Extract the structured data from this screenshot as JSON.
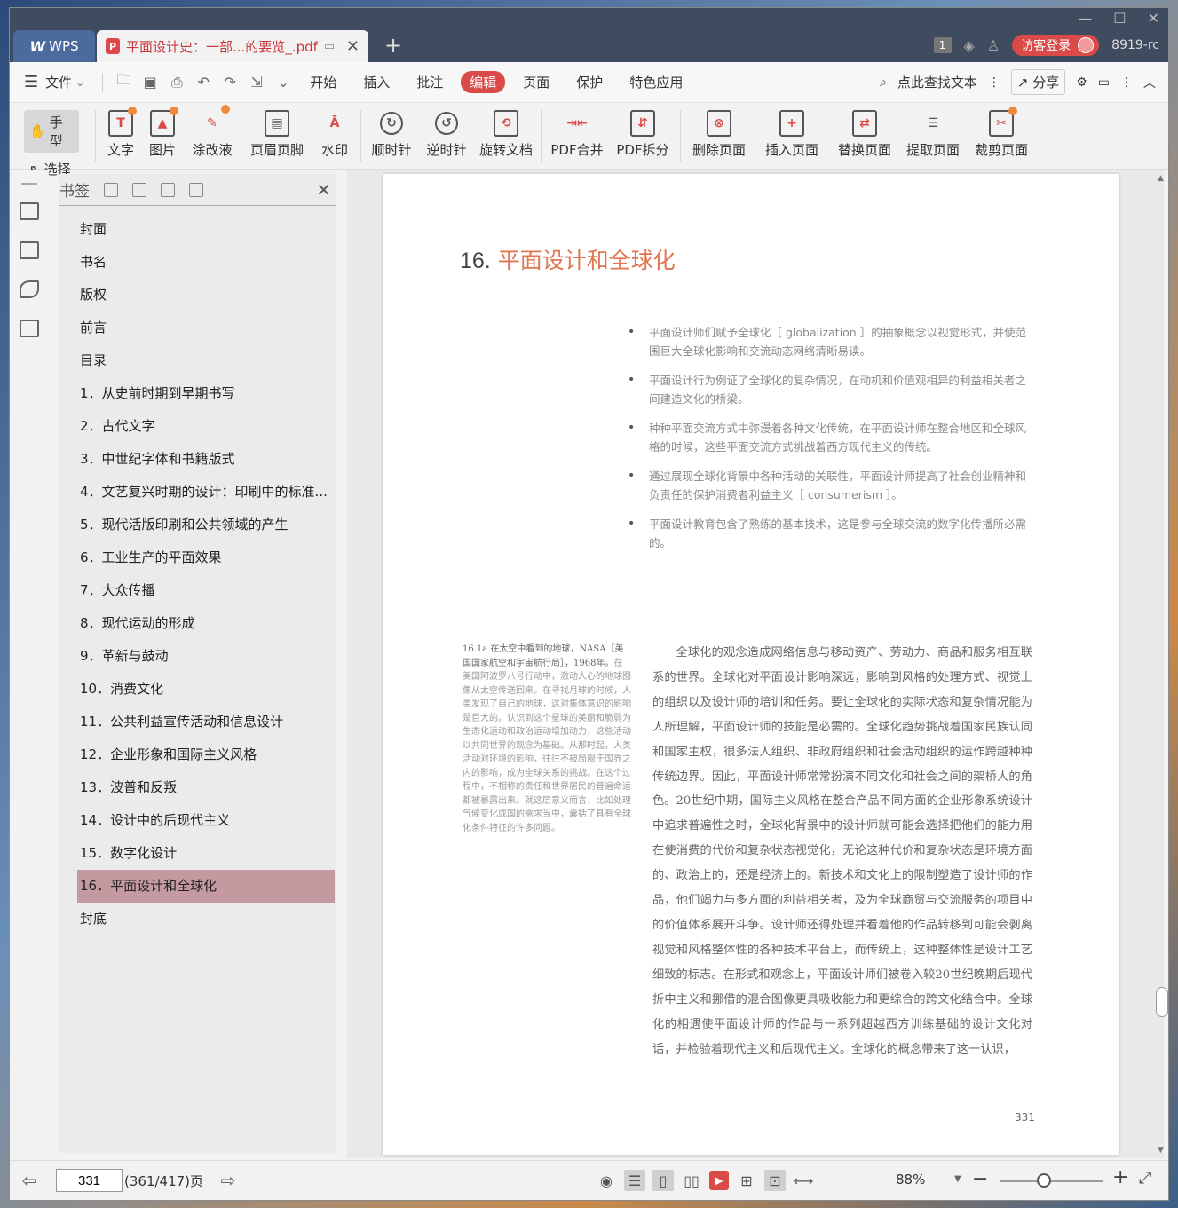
{
  "titlebar": {
    "app_tab": "WPS",
    "doc_tab": "平面设计史：一部...的要览_.pdf",
    "page_badge": "1",
    "login_button": "访客登录",
    "user_id": "8919-rc"
  },
  "menubar": {
    "file": "文件",
    "items": [
      "开始",
      "插入",
      "批注",
      "编辑",
      "页面",
      "保护",
      "特色应用"
    ],
    "active": "编辑",
    "search_text": "点此查找文本",
    "share": "分享"
  },
  "ribbon": {
    "hand": "手型",
    "select": "选择",
    "buttons": [
      "文字",
      "图片",
      "涂改液",
      "页眉页脚",
      "水印",
      "顺时针",
      "逆时针",
      "旋转文档",
      "PDF合并",
      "PDF拆分",
      "删除页面",
      "插入页面",
      "替换页面",
      "提取页面",
      "裁剪页面"
    ]
  },
  "bookmarks": {
    "title": "书签",
    "items": [
      "封面",
      "书名",
      "版权",
      "前言",
      "目录",
      "1．从史前时期到早期书写",
      "2．古代文字",
      "3．中世纪字体和书籍版式",
      "4．文艺复兴时期的设计：印刷中的标准...",
      "5．现代活版印刷和公共领域的产生",
      "6．工业生产的平面效果",
      "7．大众传播",
      "8．现代运动的形成",
      "9．革新与鼓动",
      "10．消费文化",
      "11．公共利益宣传活动和信息设计",
      "12．企业形象和国际主义风格",
      "13．波普和反叛",
      "14．设计中的后现代主义",
      "15．数字化设计",
      "16．平面设计和全球化",
      "封底"
    ],
    "active_index": 20
  },
  "page": {
    "chapter_number": "16.",
    "chapter_title": "平面设计和全球化",
    "bullets": [
      "平面设计师们赋予全球化［ globalization ］的抽象概念以视觉形式，并使范围巨大全球化影响和交流动态网络清晰易读。",
      "平面设计行为例证了全球化的复杂情况，在动机和价值观相异的利益相关者之间建造文化的桥梁。",
      "种种平面交流方式中弥漫着各种文化传统，在平面设计师在整合地区和全球风格的时候，这些平面交流方式挑战着西方现代主义的传统。",
      "通过展现全球化背景中各种活动的关联性，平面设计师提高了社会创业精神和负责任的保护消费者利益主义［ consumerism ］。",
      "平面设计教育包含了熟练的基本技术，这是参与全球交流的数字化传播所必需的。"
    ],
    "caption_head": "16.1a 在太空中看到的地球，NASA［美国国家航空和宇宙航行局］，1968年。",
    "caption_body": "在美国阿波罗八号行动中，激动人心的地球图像从太空传送回来。在寻找月球的时候，人类发现了自己的地球，这对集体意识的影响是巨大的。认识到这个星球的美丽和脆弱为生态化运动和政治运动增加动力，这些活动以共同世界的观念为基础。从那时起，人类活动对环境的影响，往往不被局限于国界之内的影响，成为全球关系的挑战。在这个过程中，不相称的责任和世界居民的普遍命运都被暴露出来。就这层意义而言，比如处理气候变化或国的需求当中，囊括了具有全球化条件特征的许多问题。",
    "body": "全球化的观念造成网络信息与移动资产、劳动力、商品和服务相互联系的世界。全球化对平面设计影响深远，影响到风格的处理方式、视觉上的组织以及设计师的培训和任务。要让全球化的实际状态和复杂情况能为人所理解，平面设计师的技能是必需的。全球化趋势挑战着国家民族认同和国家主权，很多法人组织、非政府组织和社会活动组织的运作跨越种种传统边界。因此，平面设计师常常扮演不同文化和社会之间的架桥人的角色。20世纪中期，国际主义风格在整合产品不同方面的企业形象系统设计中追求普遍性之时，全球化背景中的设计师就可能会选择把他们的能力用在使消费的代价和复杂状态视觉化，无论这种代价和复杂状态是环境方面的、政治上的，还是经济上的。新技术和文化上的限制塑造了设计师的作品，他们竭力与多方面的利益相关者，及为全球商贸与交流服务的项目中的价值体系展开斗争。设计师还得处理并看着他的作品转移到可能会剥离视觉和风格整体性的各种技术平台上，而传统上，这种整体性是设计工艺细致的标志。在形式和观念上，平面设计师们被卷入较20世纪晚期后现代折中主义和挪借的混合图像更具吸收能力和更综合的跨文化结合中。全球化的相遇使平面设计师的作品与一系列超越西方训练基础的设计文化对话，并检验着现代主义和后现代主义。全球化的概念带来了这一认识，",
    "page_number": "331"
  },
  "statusbar": {
    "page_input": "331",
    "page_count": "(361/417)页",
    "zoom": "88%"
  },
  "colors": {
    "accent": "#d94a48",
    "chapter_title": "#e07550",
    "bookmark_active": "#c49aa0"
  }
}
